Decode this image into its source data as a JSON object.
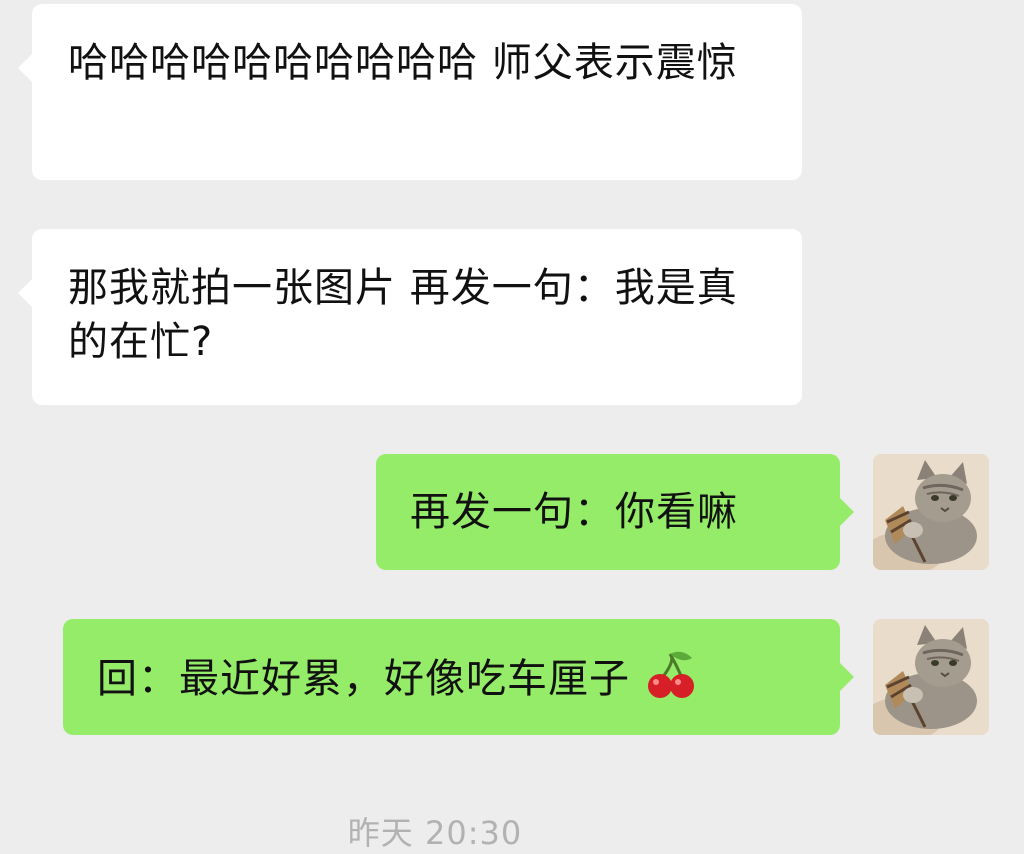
{
  "messages": [
    {
      "direction": "incoming",
      "text": "哈哈哈哈哈哈哈哈哈哈 师父表示震惊"
    },
    {
      "direction": "incoming",
      "text": "那我就拍一张图片 再发一句：我是真的在忙?"
    },
    {
      "direction": "outgoing",
      "text": "再发一句：你看嘛"
    },
    {
      "direction": "outgoing",
      "text": "回：最近好累，好像吃车厘子",
      "emoji": "cherry-icon"
    }
  ],
  "avatar": {
    "subject": "cat-avatar-icon"
  },
  "timestamp": "昨天 20:30",
  "colors": {
    "background": "#ededed",
    "incoming_bubble": "#ffffff",
    "outgoing_bubble": "#95ec69",
    "text": "#111111",
    "timestamp": "#b2b2b2"
  }
}
